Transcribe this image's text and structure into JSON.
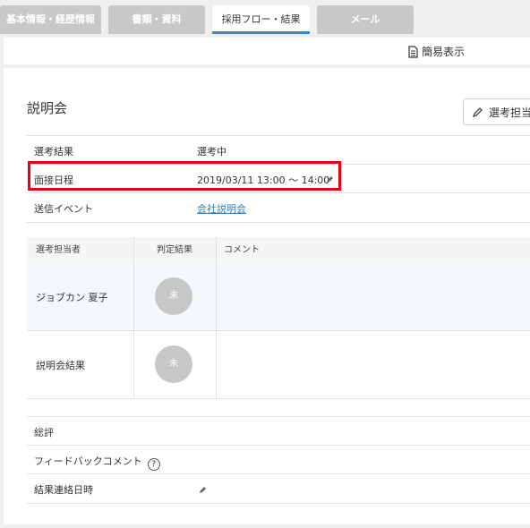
{
  "tabs": [
    {
      "label": "基本情報・経歴情報"
    },
    {
      "label": "書類・資料"
    },
    {
      "label": "採用フロー・結果"
    },
    {
      "label": "メール"
    }
  ],
  "toolbar": {
    "simple_view_label": "簡易表示"
  },
  "section": {
    "title": "説明会",
    "assign_button_label": "選考担当"
  },
  "info_rows": {
    "result": {
      "label": "選考結果",
      "value": "選考中"
    },
    "schedule": {
      "label": "面接日程",
      "value": "2019/03/11 13:00 〜 14:00"
    },
    "event": {
      "label": "送信イベント",
      "value": "会社説明会"
    }
  },
  "table": {
    "headers": {
      "assignee": "選考担当者",
      "judgement": "判定結果",
      "comment": "コメント"
    },
    "rows": [
      {
        "name": "ジョブカン 夏子",
        "status": "未"
      },
      {
        "name": "説明会結果",
        "status": "未"
      }
    ]
  },
  "bottom_rows": {
    "overall": {
      "label": "総評"
    },
    "feedback": {
      "label": "フィードバックコメント",
      "help": "?"
    },
    "contact_date": {
      "label": "結果連絡日時"
    }
  }
}
